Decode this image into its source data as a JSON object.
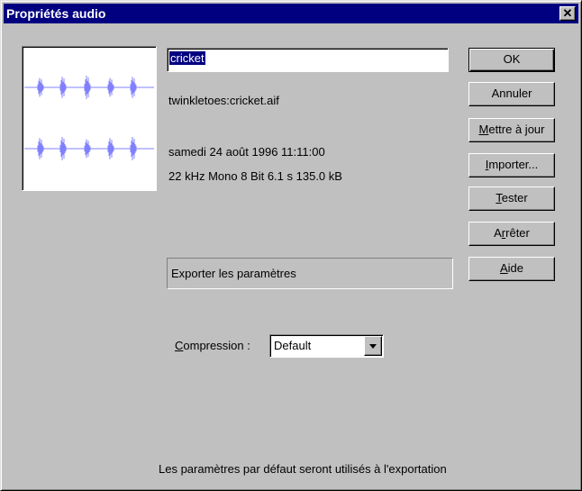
{
  "window": {
    "title": "Propriétés audio",
    "close_glyph": "✕"
  },
  "sound": {
    "name": "cricket",
    "path": "twinkletoes:cricket.aif",
    "date": "samedi 24 août 1996  11:11:00",
    "format": "22 kHz Mono 8 Bit 6.1 s 135.0 kB"
  },
  "buttons": {
    "ok": "OK",
    "cancel": "Annuler",
    "update_u": "M",
    "update_rest": "ettre à jour",
    "import_u": "I",
    "import_rest": "mporter...",
    "test_u": "T",
    "test_rest": "ester",
    "stop_pre": "A",
    "stop_u": "r",
    "stop_rest": "rêter",
    "help_u": "A",
    "help_rest": "ide"
  },
  "export": {
    "label": "Exporter les paramètres",
    "compression_u": "C",
    "compression_rest": "ompression :",
    "compression_value": "Default"
  },
  "footer": {
    "message": "Les paramètres par défaut seront utilisés à l'exportation"
  },
  "colors": {
    "titlebar": "#000080",
    "dialog": "#c0c0c0",
    "waveform": "#8080ff"
  }
}
